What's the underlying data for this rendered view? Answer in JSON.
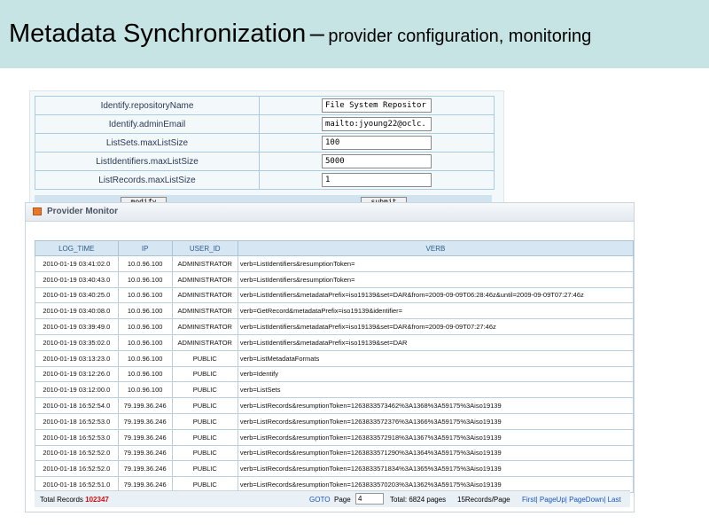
{
  "slide": {
    "title_main": "Metadata Synchronization",
    "title_dash": "–",
    "title_sub": "provider configuration, monitoring"
  },
  "config": {
    "rows": [
      {
        "label": "Identify.repositoryName",
        "value": "File System Repositor"
      },
      {
        "label": "Identify.adminEmail",
        "value": "mailto:jyoung22@oclc."
      },
      {
        "label": "ListSets.maxListSize",
        "value": "100"
      },
      {
        "label": "ListIdentifiers.maxListSize",
        "value": "5000"
      },
      {
        "label": "ListRecords.maxListSize",
        "value": "1"
      }
    ],
    "modify_label": "modify",
    "submit_label": "submit"
  },
  "monitor": {
    "title": "Provider Monitor",
    "columns": [
      "LOG_TIME",
      "IP",
      "USER_ID",
      "VERB"
    ],
    "rows": [
      [
        "2010-01-19 03:41:02.0",
        "10.0.96.100",
        "ADMINISTRATOR",
        "verb=ListIdentifiers&resumptionToken="
      ],
      [
        "2010-01-19 03:40:43.0",
        "10.0.96.100",
        "ADMINISTRATOR",
        "verb=ListIdentifiers&resumptionToken="
      ],
      [
        "2010-01-19 03:40:25.0",
        "10.0.96.100",
        "ADMINISTRATOR",
        "verb=ListIdentifiers&metadataPrefix=iso19139&set=DAR&from=2009-09-09T06:28:46z&until=2009-09-09T07:27:46z"
      ],
      [
        "2010-01-19 03:40:08.0",
        "10.0.96.100",
        "ADMINISTRATOR",
        "verb=GetRecord&metadataPrefix=iso19139&identifier="
      ],
      [
        "2010-01-19 03:39:49.0",
        "10.0.96.100",
        "ADMINISTRATOR",
        "verb=ListIdentifiers&metadataPrefix=iso19139&set=DAR&from=2009-09-09T07:27:46z"
      ],
      [
        "2010-01-19 03:35:02.0",
        "10.0.96.100",
        "ADMINISTRATOR",
        "verb=ListIdentifiers&metadataPrefix=iso19139&set=DAR"
      ],
      [
        "2010-01-19 03:13:23.0",
        "10.0.96.100",
        "PUBLIC",
        "verb=ListMetadataFormats"
      ],
      [
        "2010-01-19 03:12:26.0",
        "10.0.96.100",
        "PUBLIC",
        "verb=Identify"
      ],
      [
        "2010-01-19 03:12:00.0",
        "10.0.96.100",
        "PUBLIC",
        "verb=ListSets"
      ],
      [
        "2010-01-18 16:52:54.0",
        "79.199.36.246",
        "PUBLIC",
        "verb=ListRecords&resumptionToken=1263833573462%3A1368%3A59175%3Aiso19139"
      ],
      [
        "2010-01-18 16:52:53.0",
        "79.199.36.246",
        "PUBLIC",
        "verb=ListRecords&resumptionToken=1263833572376%3A1366%3A59175%3Aiso19139"
      ],
      [
        "2010-01-18 16:52:53.0",
        "79.199.36.246",
        "PUBLIC",
        "verb=ListRecords&resumptionToken=1263833572918%3A1367%3A59175%3Aiso19139"
      ],
      [
        "2010-01-18 16:52:52.0",
        "79.199.36.246",
        "PUBLIC",
        "verb=ListRecords&resumptionToken=1263833571290%3A1364%3A59175%3Aiso19139"
      ],
      [
        "2010-01-18 16:52:52.0",
        "79.199.36.246",
        "PUBLIC",
        "verb=ListRecords&resumptionToken=1263833571834%3A1365%3A59175%3Aiso19139"
      ],
      [
        "2010-01-18 16:52:51.0",
        "79.199.36.246",
        "PUBLIC",
        "verb=ListRecords&resumptionToken=1263833570203%3A1362%3A59175%3Aiso19139"
      ]
    ],
    "footer": {
      "total_label": "Total Records",
      "total_value": "102347",
      "goto": "GOTO",
      "page_label": "Page",
      "page_value": "4",
      "total_pages": "Total: 6824 pages",
      "per_page": "15Records/Page",
      "first": "First",
      "sep": "|",
      "page_up": "PageUp",
      "page_down": "PageDown",
      "last": "Last"
    }
  },
  "colors": {
    "title_bar": "#c5e4e3",
    "header_bg": "#d6e6f2",
    "total_red": "#d01010",
    "link_blue": "#1a55c0",
    "icon_orange": "#e8762b"
  },
  "icons": {
    "monitor": "panel-icon"
  }
}
